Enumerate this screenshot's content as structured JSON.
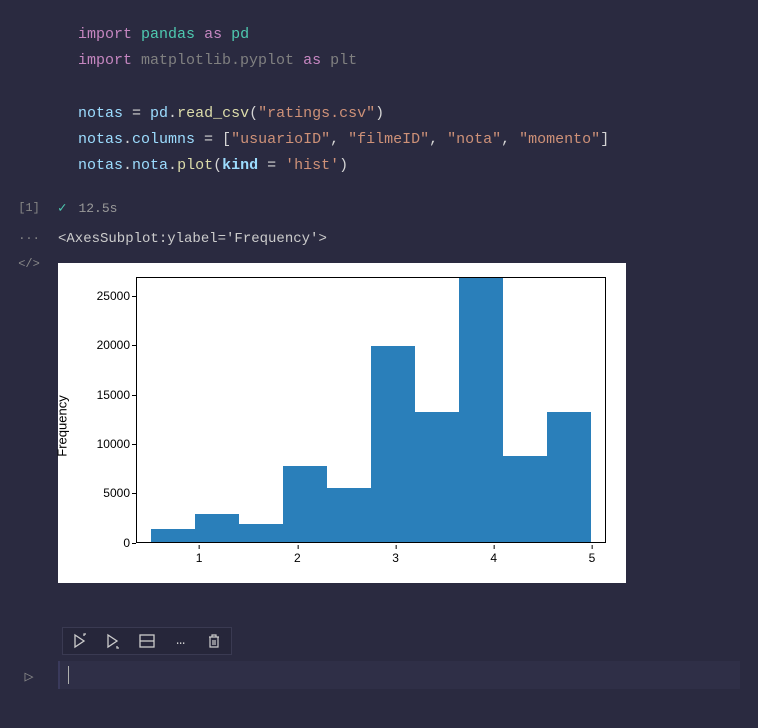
{
  "code": {
    "line1_kw1": "import",
    "line1_mod": "pandas",
    "line1_kw2": "as",
    "line1_alias": "pd",
    "line2_kw1": "import",
    "line2_mod": "matplotlib.pyplot",
    "line2_kw2": "as",
    "line2_alias": "plt",
    "line3_var": "notas",
    "line3_eq": " = ",
    "line3_obj": "pd",
    "line3_dot": ".",
    "line3_fn": "read_csv",
    "line3_p1": "(",
    "line3_str": "\"ratings.csv\"",
    "line3_p2": ")",
    "line4_var": "notas",
    "line4_dot": ".",
    "line4_attr": "columns",
    "line4_eq": " = [",
    "line4_s1": "\"usuarioID\"",
    "line4_c": ", ",
    "line4_s2": "\"filmeID\"",
    "line4_s3": "\"nota\"",
    "line4_s4": "\"momento\"",
    "line4_close": "]",
    "line5_var": "notas",
    "line5_d1": ".",
    "line5_a1": "nota",
    "line5_d2": ".",
    "line5_fn": "plot",
    "line5_p1": "(",
    "line5_kw": "kind",
    "line5_eq": " = ",
    "line5_str": "'hist'",
    "line5_p2": ")"
  },
  "gutter": {
    "exec_count": "[1]",
    "dots": "...",
    "code_icon": "</>",
    "play_icon": "▷"
  },
  "meta": {
    "check": "✓",
    "time": "12.5s"
  },
  "output_text": "<AxesSubplot:ylabel='Frequency'>",
  "chart_data": {
    "type": "bar",
    "ylabel": "Frequency",
    "xlabel": "",
    "ylim": [
      0,
      27000
    ],
    "yticks": [
      "0",
      "5000",
      "10000",
      "15000",
      "20000",
      "25000"
    ],
    "xticks": [
      "1",
      "2",
      "3",
      "4",
      "5"
    ],
    "bin_edges": [
      0.5,
      0.95,
      1.4,
      1.85,
      2.3,
      2.75,
      3.2,
      3.65,
      4.1,
      4.55,
      5.0
    ],
    "values": [
      1300,
      2800,
      1800,
      7700,
      5500,
      20000,
      13200,
      27000,
      8700,
      13200
    ]
  },
  "toolbar": {
    "run": "▷",
    "run_all": "▷",
    "split": "⊟",
    "more": "…",
    "delete": "🗑"
  }
}
